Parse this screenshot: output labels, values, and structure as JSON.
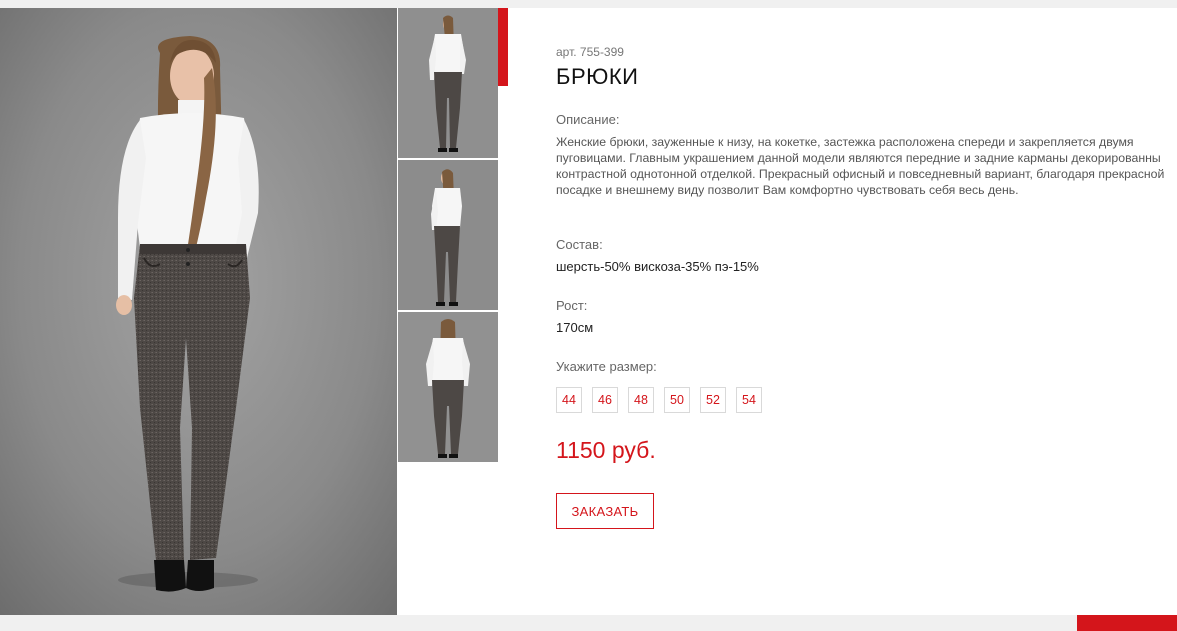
{
  "product": {
    "sku": "арт. 755-399",
    "title": "БРЮКИ",
    "description_label": "Описание:",
    "description": "Женские брюки, зауженные к низу, на кокетке, застежка расположена спереди и закрепляется двумя пуговицами. Главным украшением данной модели являются передние и задние карманы декорированны контрастной однотонной отделкой. Прекрасный офисный и повседневный вариант, благодаря прекрасной посадке и внешнему виду позволит Вам комфортно чувствовать себя весь день.",
    "composition_label": "Состав:",
    "composition": "шерсть-50% вискоза-35% пэ-15%",
    "height_label": "Рост:",
    "height": "170см",
    "size_label": "Укажите размер:",
    "sizes": [
      "44",
      "46",
      "48",
      "50",
      "52",
      "54"
    ],
    "price": "1150 руб.",
    "order_button": "ЗАКАЗАТЬ"
  },
  "gallery": {
    "main_image": "model-front-photo",
    "thumbnails": [
      "model-front-thumb",
      "model-side-thumb",
      "model-back-thumb"
    ],
    "active_thumbnail": 0
  },
  "colors": {
    "accent": "#d4151b",
    "text": "#555555",
    "background": "#ffffff"
  }
}
